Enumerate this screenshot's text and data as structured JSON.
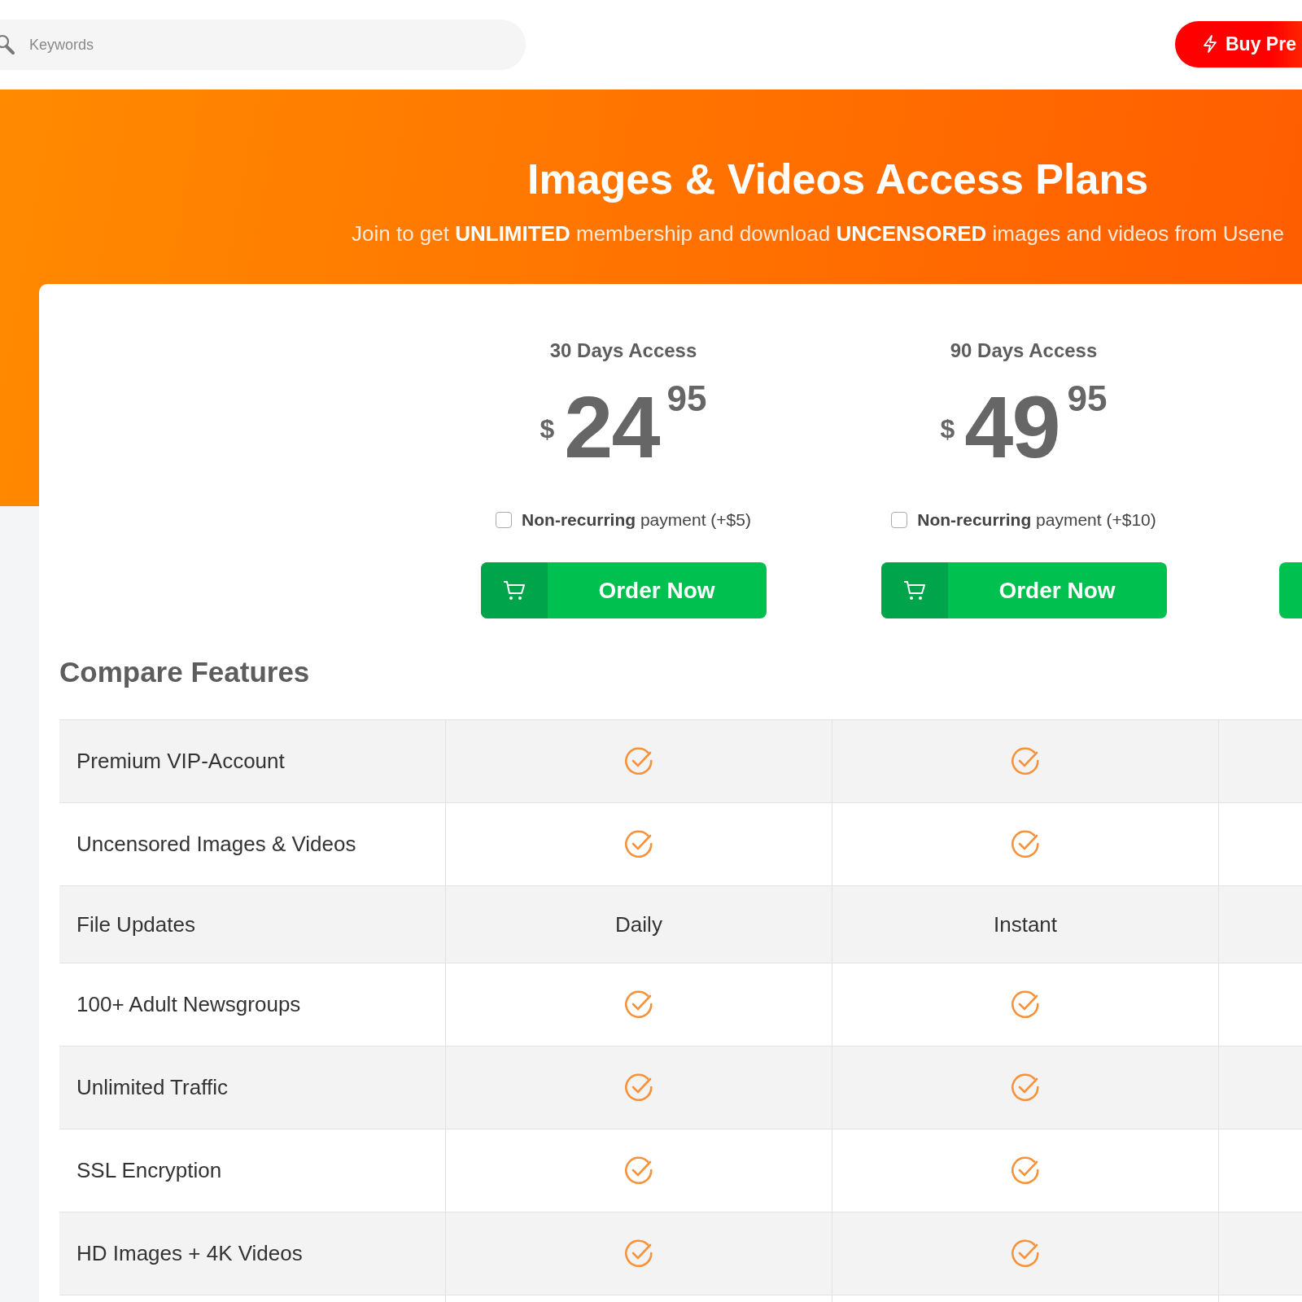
{
  "header": {
    "search": {
      "placeholder": "Keywords"
    },
    "buy_button": {
      "label": "Buy Pre"
    }
  },
  "hero": {
    "title": "Images & Videos Access Plans",
    "subtitle": "Join to get **UNLIMITED** membership and download **UNCENSORED** images and videos from Usene"
  },
  "plans": [
    {
      "kind": "full",
      "title": "30 Days Access",
      "currency": "$",
      "price": "24",
      "cents": "95",
      "option": {
        "label": "**Non-recurring** payment (+$5)",
        "checked": false
      },
      "order_button": "Order Now"
    },
    {
      "kind": "full",
      "title": "90 Days Access",
      "currency": "$",
      "price": "49",
      "cents": "95",
      "option": {
        "label": "**Non-recurring** payment (+$10)",
        "checked": false
      },
      "order_button": "Order Now"
    },
    {
      "kind": "cut_off"
    }
  ],
  "compare": {
    "heading": "Compare Features",
    "rows": [
      {
        "feature": "Premium VIP-Account",
        "values": [
          {
            "kind": "check"
          },
          {
            "kind": "check"
          }
        ]
      },
      {
        "feature": "Uncensored Images & Videos",
        "values": [
          {
            "kind": "check"
          },
          {
            "kind": "check"
          }
        ]
      },
      {
        "feature": "File Updates",
        "values": [
          {
            "kind": "text",
            "text": "Daily"
          },
          {
            "kind": "text",
            "text": "Instant"
          }
        ]
      },
      {
        "feature": "100+ Adult Newsgroups",
        "values": [
          {
            "kind": "check"
          },
          {
            "kind": "check"
          }
        ]
      },
      {
        "feature": "Unlimited Traffic",
        "values": [
          {
            "kind": "check"
          },
          {
            "kind": "check"
          }
        ]
      },
      {
        "feature": "SSL Encryption",
        "values": [
          {
            "kind": "check"
          },
          {
            "kind": "check"
          }
        ]
      },
      {
        "feature": "HD Images + 4K Videos",
        "values": [
          {
            "kind": "check"
          },
          {
            "kind": "check"
          }
        ]
      }
    ]
  }
}
